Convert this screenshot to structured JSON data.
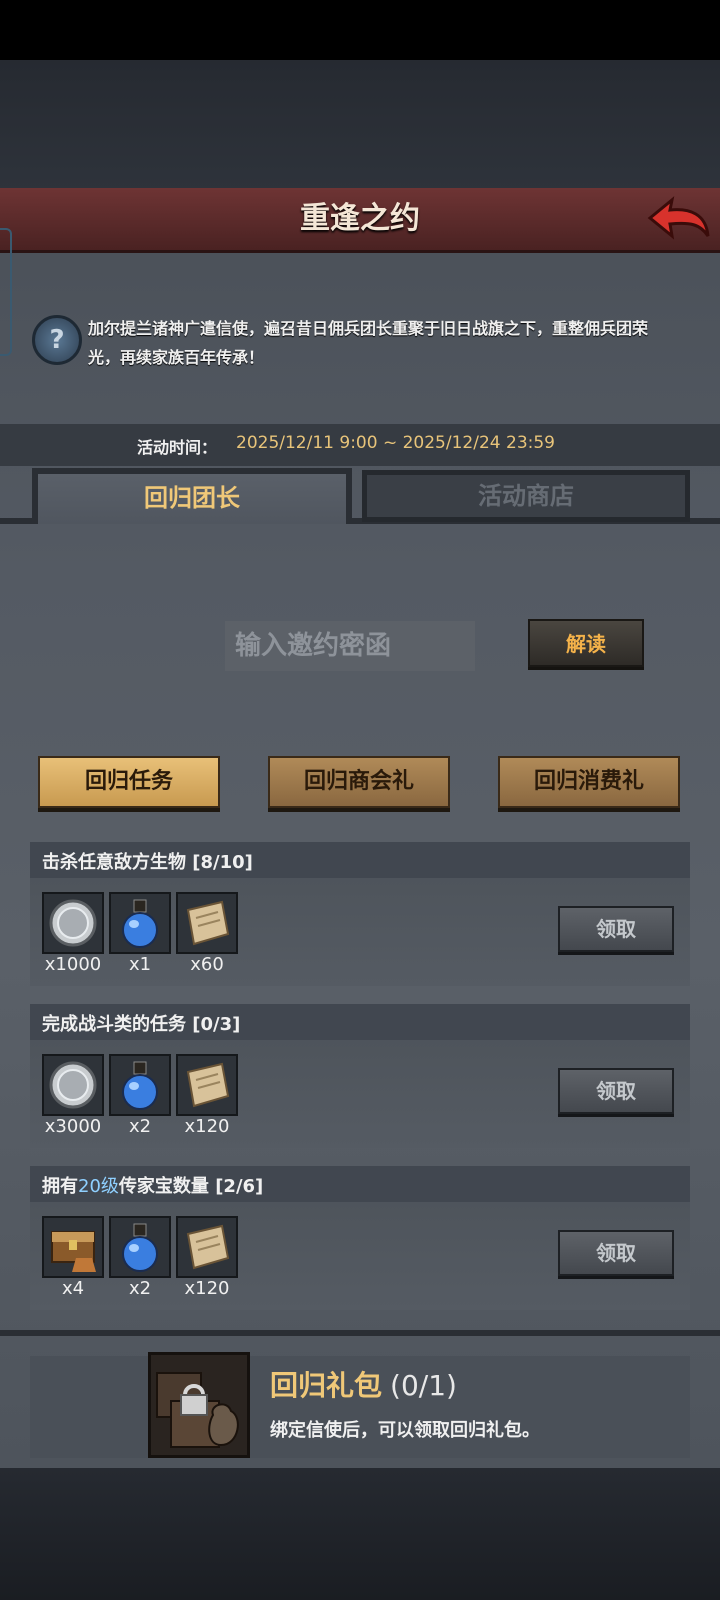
{
  "header": {
    "title": "重逢之约"
  },
  "intro": {
    "text": "加尔提兰诸神广遣信使，遍召昔日佣兵团长重聚于旧日战旗之下，重整佣兵团荣光，再续家族百年传承！"
  },
  "activity_time": {
    "label": "活动时间：",
    "value": "2025/12/11 9:00 ~ 2025/12/24 23:59"
  },
  "tabs": [
    {
      "label": "回归团长",
      "active": true
    },
    {
      "label": "活动商店",
      "active": false
    }
  ],
  "code": {
    "placeholder": "输入邀约密函",
    "button": "解读"
  },
  "categories": [
    {
      "label": "回归任务",
      "active": true
    },
    {
      "label": "回归商会礼",
      "active": false
    },
    {
      "label": "回归消费礼",
      "active": false
    }
  ],
  "tasks": [
    {
      "title": "击杀任意敌方生物",
      "progress": "[8/10]",
      "rewards": [
        {
          "icon": "silver-coin-icon",
          "qty": "x1000"
        },
        {
          "icon": "blue-potion-icon",
          "qty": "x1"
        },
        {
          "icon": "scroll-icon",
          "qty": "x60"
        }
      ],
      "button": "领取"
    },
    {
      "title": "完成战斗类的任务",
      "progress": "[0/3]",
      "rewards": [
        {
          "icon": "silver-coin-icon",
          "qty": "x3000"
        },
        {
          "icon": "blue-potion-icon",
          "qty": "x2"
        },
        {
          "icon": "scroll-icon",
          "qty": "x120"
        }
      ],
      "button": "领取"
    },
    {
      "title": "拥有",
      "title_level": "20级",
      "title_rest": "传家宝数量",
      "progress": "[2/6]",
      "rewards": [
        {
          "icon": "treasure-chest-icon",
          "qty": "x4"
        },
        {
          "icon": "blue-potion-icon",
          "qty": "x2"
        },
        {
          "icon": "scroll-icon",
          "qty": "x120"
        }
      ],
      "button": "领取"
    }
  ],
  "gift": {
    "title": "回归礼包",
    "count": "(0/1)",
    "desc": "绑定信使后，可以领取回归礼包。",
    "icon": "locked-gift-icon"
  },
  "colors": {
    "gold": "#f0c878",
    "time": "#e8c47a",
    "header": "#6e3434",
    "level": "#8fd0ff"
  }
}
